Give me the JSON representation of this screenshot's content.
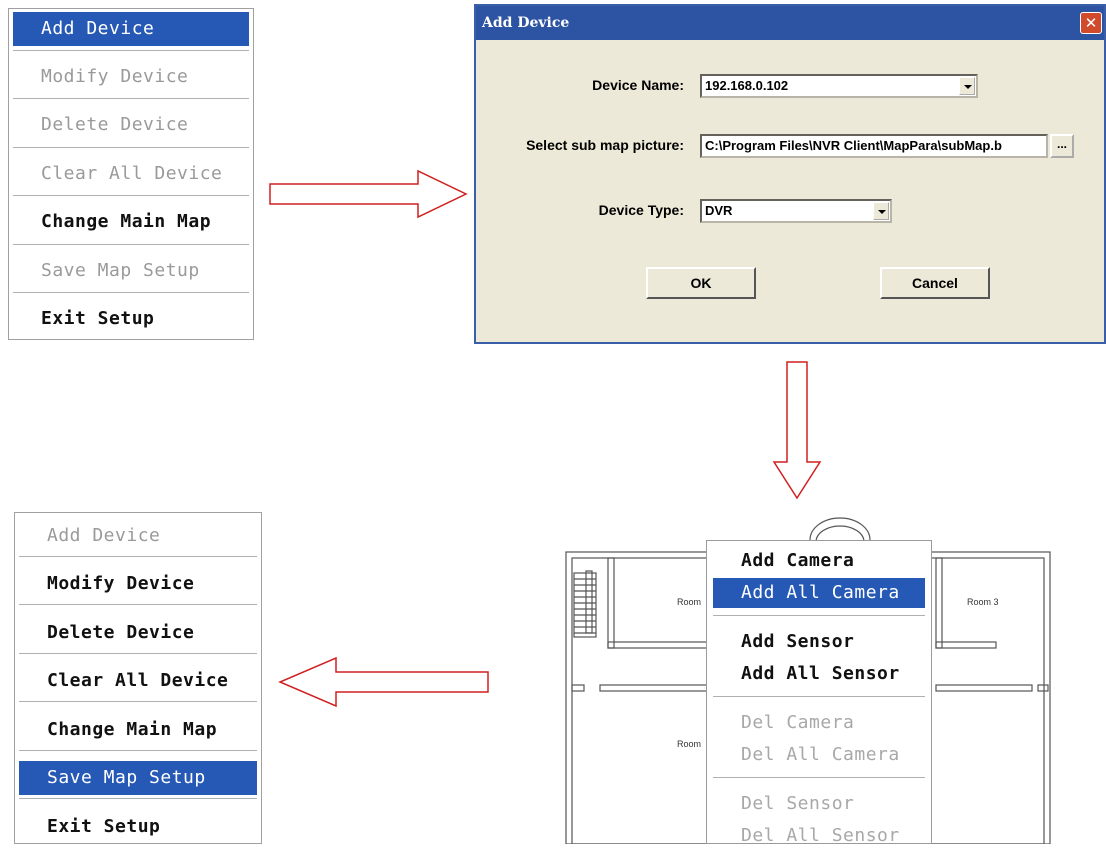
{
  "menu_top": {
    "items": [
      {
        "label": "Add Device",
        "state": "selected"
      },
      {
        "label": "Modify Device",
        "state": "disabled"
      },
      {
        "label": "Delete Device",
        "state": "disabled"
      },
      {
        "label": "Clear All Device",
        "state": "disabled"
      },
      {
        "label": "Change Main Map",
        "state": "enabled"
      },
      {
        "label": "Save Map Setup",
        "state": "disabled"
      },
      {
        "label": "Exit Setup",
        "state": "enabled"
      }
    ]
  },
  "dialog": {
    "title": "Add Device",
    "close_glyph": "✕",
    "device_name_label": "Device Name:",
    "device_name_value": "192.168.0.102",
    "submap_label": "Select sub map picture:",
    "submap_value": "C:\\Program Files\\NVR Client\\MapPara\\subMap.b",
    "browse_label": "...",
    "device_type_label": "Device Type:",
    "device_type_value": "DVR",
    "ok_label": "OK",
    "cancel_label": "Cancel"
  },
  "floor_plan": {
    "room_left_top": "Room",
    "room_right_top": "Room 3",
    "room_left_bottom": "Room"
  },
  "context_menu": {
    "items": [
      {
        "label": "Add Camera",
        "state": "enabled"
      },
      {
        "label": "Add All Camera",
        "state": "selected"
      },
      {
        "label": "Add Sensor",
        "state": "enabled"
      },
      {
        "label": "Add All Sensor",
        "state": "enabled"
      },
      {
        "label": "Del Camera",
        "state": "disabled"
      },
      {
        "label": "Del All Camera",
        "state": "disabled"
      },
      {
        "label": "Del Sensor",
        "state": "disabled"
      },
      {
        "label": "Del All Sensor",
        "state": "disabled"
      }
    ]
  },
  "menu_bottom": {
    "items": [
      {
        "label": "Add Device",
        "state": "disabled"
      },
      {
        "label": "Modify Device",
        "state": "enabled"
      },
      {
        "label": "Delete Device",
        "state": "enabled"
      },
      {
        "label": "Clear All Device",
        "state": "enabled"
      },
      {
        "label": "Change Main Map",
        "state": "enabled"
      },
      {
        "label": "Save Map Setup",
        "state": "selected"
      },
      {
        "label": "Exit Setup",
        "state": "enabled"
      }
    ]
  },
  "colors": {
    "selection": "#2659b5",
    "arrow": "#d02020",
    "dialog_bg": "#ece9d8",
    "titlebar": "#2d54a3"
  }
}
